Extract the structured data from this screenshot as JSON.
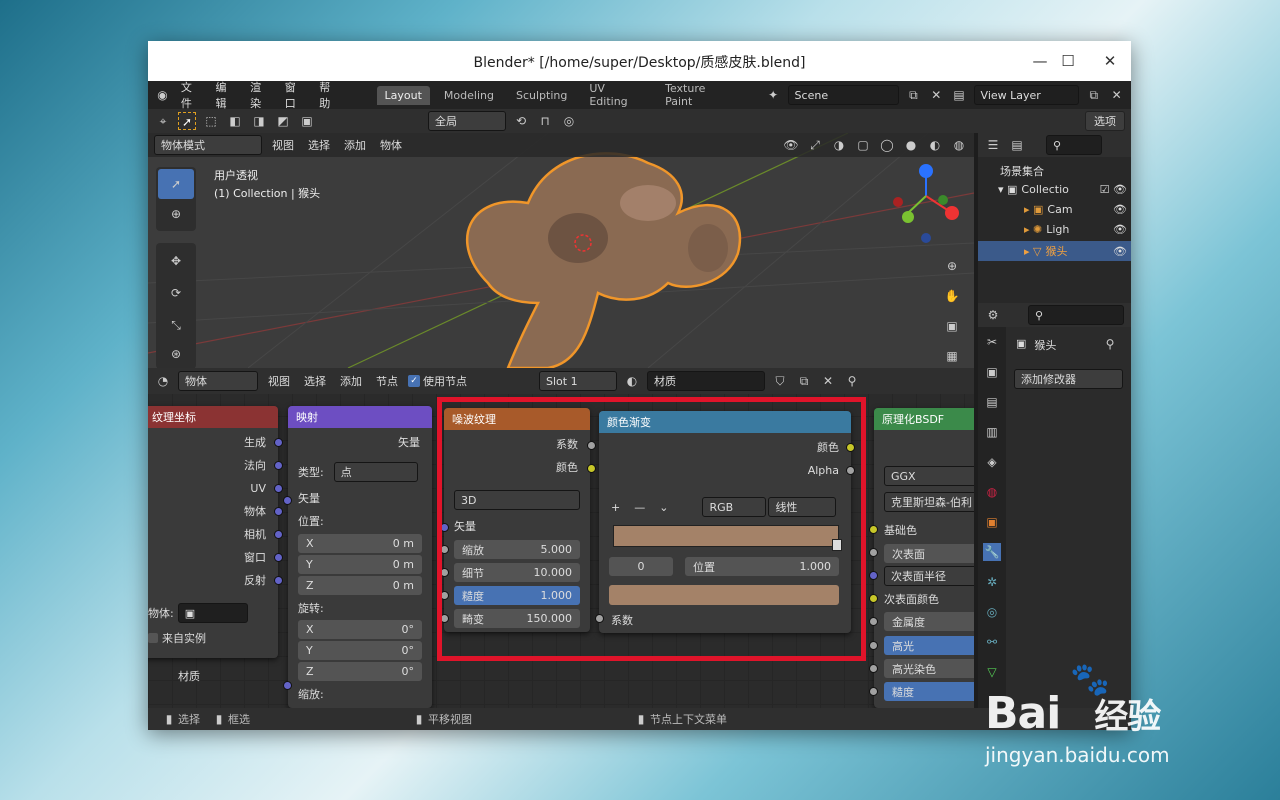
{
  "window": {
    "title": "Blender* [/home/super/Desktop/质感皮肤.blend]"
  },
  "menu": {
    "items": [
      "文件",
      "编辑",
      "渲染",
      "窗口",
      "帮助"
    ]
  },
  "workspaces": {
    "tabs": [
      "Layout",
      "Modeling",
      "Sculpting",
      "UV Editing",
      "Texture Paint"
    ],
    "active": "Layout"
  },
  "scene": {
    "name": "Scene",
    "view_layer": "View Layer"
  },
  "viewport": {
    "transform": "全局",
    "options": "选项",
    "mode": "物体模式",
    "menus": [
      "视图",
      "选择",
      "添加",
      "物体"
    ],
    "view_name": "用户透视",
    "collection_label": "(1) Collection | 猴头"
  },
  "node_editor": {
    "type": "物体",
    "menus": [
      "视图",
      "选择",
      "添加",
      "节点"
    ],
    "use_nodes_label": "使用节点",
    "slot": "Slot 1",
    "material": "材质",
    "bottom_label": "材质",
    "nodes": {
      "texcoord": {
        "title": "纹理坐标",
        "outputs": [
          "生成",
          "法向",
          "UV",
          "物体",
          "相机",
          "窗口",
          "反射"
        ],
        "object_label": "物体:",
        "instance_label": "来自实例"
      },
      "mapping": {
        "title": "映射",
        "out": "矢量",
        "type_label": "类型:",
        "type_value": "点",
        "vector": "矢量",
        "location": "位置:",
        "loc": [
          {
            "k": "X",
            "v": "0 m"
          },
          {
            "k": "Y",
            "v": "0 m"
          },
          {
            "k": "Z",
            "v": "0 m"
          }
        ],
        "rotation": "旋转:",
        "rot": [
          {
            "k": "X",
            "v": "0°"
          },
          {
            "k": "Y",
            "v": "0°"
          },
          {
            "k": "Z",
            "v": "0°"
          }
        ],
        "scale": "缩放:"
      },
      "noise": {
        "title": "噪波纹理",
        "out1": "系数",
        "out2": "颜色",
        "dim": "3D",
        "vector": "矢量",
        "params": [
          {
            "k": "缩放",
            "v": "5.000"
          },
          {
            "k": "细节",
            "v": "10.000"
          },
          {
            "k": "糙度",
            "v": "1.000"
          },
          {
            "k": "畸变",
            "v": "150.000"
          }
        ]
      },
      "ramp": {
        "title": "颜色渐变",
        "out1": "颜色",
        "out2": "Alpha",
        "mode": "RGB",
        "interp": "线性",
        "index": "0",
        "pos_label": "位置",
        "pos_value": "1.000",
        "input": "系数",
        "color": "#a48268"
      },
      "bsdf": {
        "title": "原理化BSDF",
        "dist": "GGX",
        "sss": "克里斯坦森-伯利",
        "inputs": [
          "基础色",
          "次表面",
          "次表面半径",
          "次表面颜色",
          "金属度",
          "高光",
          "高光染色",
          "糙度"
        ]
      }
    }
  },
  "outliner": {
    "root": "场景集合",
    "collection": "Collectio",
    "items": [
      "Cam",
      "Ligh",
      "猴头"
    ]
  },
  "properties": {
    "object": "猴头",
    "add_modifier": "添加修改器"
  },
  "status": {
    "select": "选择",
    "box": "框选",
    "pan": "平移视图",
    "context": "节点上下文菜单"
  },
  "watermark": {
    "brand": "Bai",
    "brand2": "经验",
    "url": "jingyan.baidu.com"
  }
}
